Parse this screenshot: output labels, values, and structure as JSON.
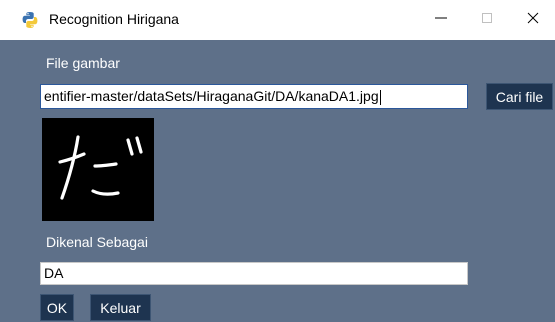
{
  "window": {
    "title": "Recognition Hirigana",
    "app_icon": "python-icon",
    "controls": {
      "minimize": "minimize-icon",
      "maximize": "maximize-icon",
      "close": "close-icon"
    }
  },
  "form": {
    "file_label": "File gambar",
    "file_path": "entifier-master/dataSets/HiraganaGit/DA/kanaDA1.jpg",
    "browse_button": "Cari file",
    "preview_image": "hiragana-da-character",
    "recognized_label": "Dikenal Sebagai",
    "recognized_value": "DA",
    "ok_button": "OK",
    "exit_button": "Keluar"
  },
  "colors": {
    "background": "#5e7089",
    "button": "#1e3450",
    "text": "#ffffff"
  }
}
